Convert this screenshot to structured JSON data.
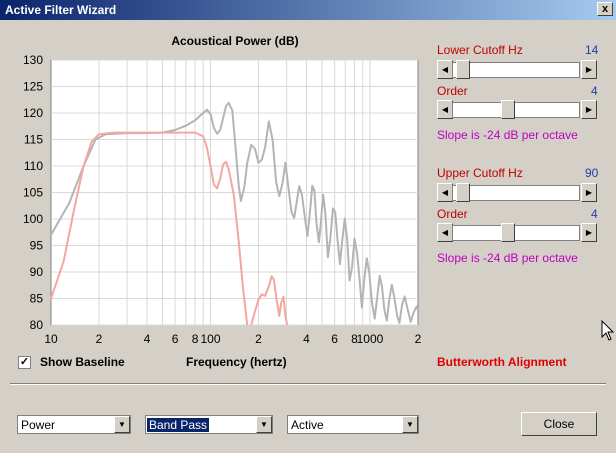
{
  "window": {
    "title": "Active Filter Wizard",
    "close_glyph": "x"
  },
  "controls": {
    "lower_cutoff": {
      "label": "Lower Cutoff  Hz",
      "value": "14",
      "position": 0.03
    },
    "lower_order": {
      "label": "Order",
      "value": "4",
      "position": 0.42
    },
    "lower_slope": "Slope is -24 dB per octave",
    "upper_cutoff": {
      "label": "Upper Cutoff  Hz",
      "value": "90",
      "position": 0.03
    },
    "upper_order": {
      "label": "Order",
      "value": "4",
      "position": 0.42
    },
    "upper_slope": "Slope is -24 dB per octave"
  },
  "show_baseline": {
    "label": "Show Baseline",
    "checked": true
  },
  "alignment_label": "Butterworth Alignment",
  "dropdowns": {
    "mode": "Power",
    "filter_type": "Band Pass",
    "filter_kind": "Active"
  },
  "close_button": "Close",
  "colors": {
    "baseline": "#b4b4b4",
    "filtered": "#f4a6a0",
    "red_text": "#c00000"
  },
  "chart_data": {
    "type": "line",
    "title": "Acoustical Power (dB)",
    "xlabel": "Frequency (hertz)",
    "ylabel": "",
    "x_scale": "log",
    "xlim": [
      10,
      2000
    ],
    "ylim": [
      80,
      130
    ],
    "y_ticks": [
      80,
      85,
      90,
      95,
      100,
      105,
      110,
      115,
      120,
      125,
      130
    ],
    "x_ticks": [
      {
        "value": 10,
        "label": "10"
      },
      {
        "value": 20,
        "label": "2"
      },
      {
        "value": 40,
        "label": "4"
      },
      {
        "value": 60,
        "label": "6"
      },
      {
        "value": 80,
        "label": "8"
      },
      {
        "value": 100,
        "label": "100"
      },
      {
        "value": 200,
        "label": "2"
      },
      {
        "value": 400,
        "label": "4"
      },
      {
        "value": 600,
        "label": "6"
      },
      {
        "value": 800,
        "label": "8"
      },
      {
        "value": 1000,
        "label": "1000"
      },
      {
        "value": 2000,
        "label": "2"
      }
    ],
    "grid": true,
    "series": [
      {
        "name": "",
        "color": "#b4b4b4",
        "points": [
          [
            10,
            97
          ],
          [
            13,
            103
          ],
          [
            16,
            110
          ],
          [
            19,
            115
          ],
          [
            22,
            116
          ],
          [
            30,
            116.2
          ],
          [
            40,
            116.2
          ],
          [
            50,
            116.3
          ],
          [
            60,
            116.8
          ],
          [
            70,
            117.6
          ],
          [
            80,
            118.6
          ],
          [
            90,
            120
          ],
          [
            95,
            120.6
          ],
          [
            100,
            119.8
          ],
          [
            105,
            117.2
          ],
          [
            110,
            116.1
          ],
          [
            115,
            116.8
          ],
          [
            120,
            119
          ],
          [
            125,
            121.3
          ],
          [
            130,
            121.9
          ],
          [
            137,
            120.5
          ],
          [
            143,
            114
          ],
          [
            150,
            106.5
          ],
          [
            155,
            103.4
          ],
          [
            163,
            106
          ],
          [
            170,
            110.5
          ],
          [
            180,
            114
          ],
          [
            190,
            113.2
          ],
          [
            200,
            110.6
          ],
          [
            210,
            111.2
          ],
          [
            220,
            113.5
          ],
          [
            232,
            118.4
          ],
          [
            245,
            115
          ],
          [
            258,
            107
          ],
          [
            270,
            104.3
          ],
          [
            283,
            106.8
          ],
          [
            295,
            110.6
          ],
          [
            308,
            106
          ],
          [
            322,
            101.3
          ],
          [
            335,
            100.2
          ],
          [
            348,
            103.4
          ],
          [
            360,
            106.2
          ],
          [
            375,
            104.5
          ],
          [
            390,
            100.4
          ],
          [
            405,
            96.8
          ],
          [
            420,
            101.2
          ],
          [
            435,
            106.3
          ],
          [
            448,
            105.4
          ],
          [
            462,
            99.2
          ],
          [
            478,
            95.6
          ],
          [
            492,
            99.4
          ],
          [
            508,
            104.6
          ],
          [
            525,
            101
          ],
          [
            545,
            92.8
          ],
          [
            565,
            96.5
          ],
          [
            585,
            102
          ],
          [
            605,
            101.3
          ],
          [
            625,
            96.4
          ],
          [
            648,
            91.5
          ],
          [
            670,
            95.9
          ],
          [
            695,
            100.1
          ],
          [
            720,
            96.1
          ],
          [
            745,
            88.4
          ],
          [
            772,
            91
          ],
          [
            800,
            96.3
          ],
          [
            830,
            93.5
          ],
          [
            860,
            88.8
          ],
          [
            890,
            83.3
          ],
          [
            920,
            88.5
          ],
          [
            955,
            92.6
          ],
          [
            990,
            89.8
          ],
          [
            1030,
            84.2
          ],
          [
            1070,
            81.2
          ],
          [
            1110,
            85.2
          ],
          [
            1150,
            89.3
          ],
          [
            1190,
            87.2
          ],
          [
            1230,
            83
          ],
          [
            1275,
            80.8
          ],
          [
            1320,
            84.7
          ],
          [
            1370,
            87.6
          ],
          [
            1420,
            85.2
          ],
          [
            1480,
            81.8
          ],
          [
            1530,
            80.4
          ],
          [
            1590,
            83.8
          ],
          [
            1650,
            85.4
          ],
          [
            1720,
            83
          ],
          [
            1800,
            80.6
          ],
          [
            1880,
            82.4
          ],
          [
            1960,
            83.5
          ],
          [
            2000,
            82.8
          ]
        ]
      },
      {
        "name": "",
        "color": "#f4a6a0",
        "points": [
          [
            10,
            85
          ],
          [
            12,
            92
          ],
          [
            14,
            102
          ],
          [
            16,
            110
          ],
          [
            18,
            114.6
          ],
          [
            20,
            116
          ],
          [
            25,
            116.3
          ],
          [
            40,
            116.3
          ],
          [
            60,
            116.3
          ],
          [
            80,
            116.3
          ],
          [
            90,
            115.6
          ],
          [
            95,
            113.5
          ],
          [
            100,
            110
          ],
          [
            105,
            106.5
          ],
          [
            110,
            105.8
          ],
          [
            115,
            107.6
          ],
          [
            120,
            110.3
          ],
          [
            125,
            110.8
          ],
          [
            130,
            109.4
          ],
          [
            140,
            104.5
          ],
          [
            150,
            96
          ],
          [
            160,
            87
          ],
          [
            170,
            80
          ]
        ]
      },
      {
        "name": "",
        "color": "#f4a6a0",
        "points": [
          [
            180,
            80
          ],
          [
            190,
            82.6
          ],
          [
            200,
            84.8
          ],
          [
            210,
            85.8
          ],
          [
            220,
            85.5
          ],
          [
            232,
            87.3
          ],
          [
            242,
            89.2
          ],
          [
            250,
            88.5
          ],
          [
            260,
            84.6
          ],
          [
            270,
            81.7
          ],
          [
            278,
            84.3
          ],
          [
            287,
            85.3
          ],
          [
            295,
            81.8
          ],
          [
            302,
            80
          ]
        ]
      }
    ]
  }
}
